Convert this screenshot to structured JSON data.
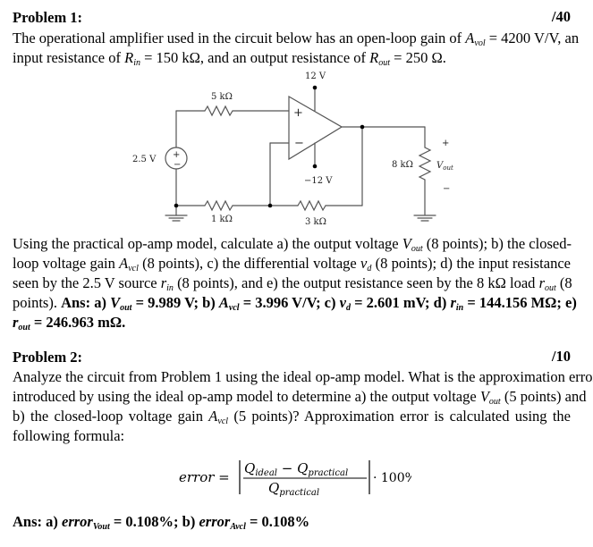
{
  "problem1": {
    "title": "Problem 1:",
    "score": "/40",
    "intro": {
      "l1_a": "The operational amplifier used in the circuit below has an open-loop gain of ",
      "avol_sym": "A",
      "avol_sub": "vol",
      "l1_b": " = 4200 V/V, an",
      "l2_a": "input resistance of ",
      "rin_sym": "R",
      "rin_sub": "in",
      "l2_b": " = 150 kΩ, and an output resistance of ",
      "rout_sym": "R",
      "rout_sub": "out",
      "l2_c": " = 250 Ω."
    },
    "circuit": {
      "vplus": "12 V",
      "vminus": "−12 V",
      "source": "2.5 V",
      "r_input": "5 kΩ",
      "r_ground": "1 kΩ",
      "r_feedback": "3 kΩ",
      "r_load": "8 kΩ",
      "vout_label": "V",
      "vout_sub": "out",
      "plus": "+",
      "minus": "−"
    },
    "question": {
      "l1_a": "Using the practical op-amp model, calculate a) the output voltage ",
      "l1_b": " (8 points); b) the closed-",
      "l2_a": "loop voltage gain ",
      "l2_b": " (8 points), c) the differential voltage ",
      "l2_c": " (8 points); d) the input resistance",
      "l3_a": "seen by the 2.5 V source ",
      "l3_b": " (8 points), and e) the output resistance seen by the 8 kΩ load ",
      "l3_c": " (8",
      "l4_a": "points). ",
      "ans_label": "Ans: a) ",
      "ans_a": " = 9.989 V; b) ",
      "ans_b": " = 3.996 V/V; c) ",
      "ans_c": " = 2.601 mV; d) ",
      "ans_d": " = 144.156 MΩ; e)",
      "ans_e": " = 246.963 mΩ."
    }
  },
  "symbols": {
    "V": "V",
    "out": "out",
    "A": "A",
    "vcl": "vcl",
    "v": "v",
    "d": "d",
    "r": "r",
    "in": "in"
  },
  "problem2": {
    "title": "Problem 2:",
    "score": "/10",
    "l1": "Analyze the circuit from Problem 1 using the ideal op-amp model. What is the approximation error",
    "l2_a": "introduced by using the ideal op-amp model to determine a) the output voltage ",
    "l2_b": " (5 points) and",
    "l3_a": "b) the closed-loop voltage gain ",
    "l3_b": " (5 points)? Approximation error is calculated using the",
    "l4": "following formula:",
    "formula": {
      "lhs": "error =",
      "num_a": "Q",
      "num_a_sub": "ideal",
      "num_op": " − ",
      "num_b": "Q",
      "num_b_sub": "practical",
      "den": "Q",
      "den_sub": "practical",
      "rhs": "· 100%"
    },
    "answer": {
      "label": "Ans: a) ",
      "err": "error",
      "sub_a": "Vout",
      "val_a": " = 0.108%; b) ",
      "sub_b": "Avcl",
      "val_b": " = 0.108%"
    }
  }
}
